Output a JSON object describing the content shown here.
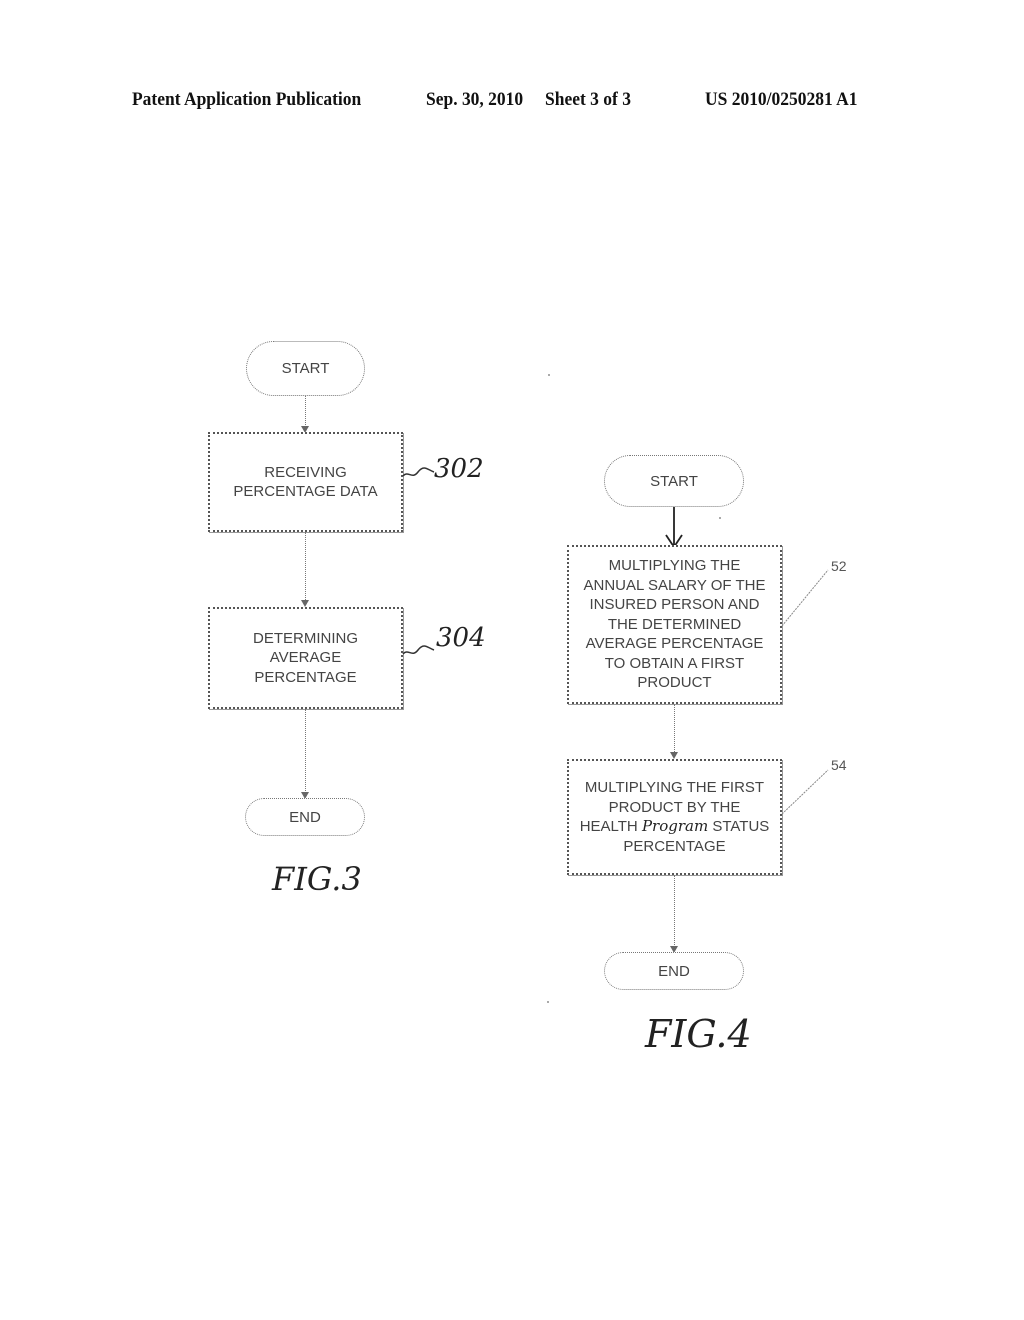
{
  "header": {
    "publication": "Patent Application Publication",
    "date": "Sep. 30, 2010",
    "sheet": "Sheet 3 of 3",
    "number": "US 2010/0250281 A1"
  },
  "fig3": {
    "start": "START",
    "steps": [
      {
        "ref": "302",
        "lines": [
          "RECEIVING",
          "PERCENTAGE DATA"
        ]
      },
      {
        "ref": "304",
        "lines": [
          "DETERMINING",
          "AVERAGE",
          "PERCENTAGE"
        ]
      }
    ],
    "end": "END",
    "label": "FIG.3"
  },
  "fig4": {
    "start": "START",
    "steps": [
      {
        "ref": "52",
        "lines": [
          "MULTIPLYING THE",
          "ANNUAL SALARY OF THE",
          "INSURED PERSON AND",
          "THE DETERMINED",
          "AVERAGE PERCENTAGE",
          "TO OBTAIN A FIRST",
          "PRODUCT"
        ]
      },
      {
        "ref": "54",
        "lines_before": [
          "MULTIPLYING THE FIRST",
          "PRODUCT BY THE"
        ],
        "line3_prefix": "HEALTH ",
        "line3_handwritten": "Program",
        "line3_suffix": " STATUS",
        "lines_after": [
          "PERCENTAGE"
        ]
      }
    ],
    "end": "END",
    "label": "FIG.4"
  }
}
